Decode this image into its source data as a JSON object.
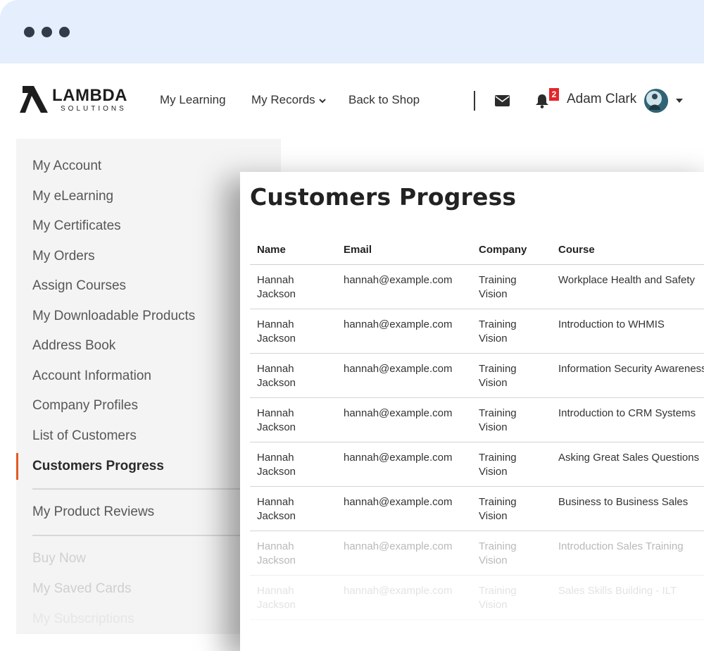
{
  "header": {
    "logo_text": "LAMBDA",
    "logo_sub": "SOLUTIONS",
    "nav": {
      "my_learning": "My Learning",
      "my_records": "My Records",
      "back_to_shop": "Back to Shop"
    },
    "notification_count": "2",
    "user_name": "Adam Clark",
    "icons": [
      "mail-icon",
      "bell-icon",
      "chevron-down-icon",
      "caret-down-icon"
    ]
  },
  "sidebar": {
    "accent_color": "#e25a22",
    "items": [
      {
        "label": "My Account"
      },
      {
        "label": "My eLearning"
      },
      {
        "label": "My Certificates"
      },
      {
        "label": "My Orders"
      },
      {
        "label": "Assign Courses"
      },
      {
        "label": "My Downloadable Products"
      },
      {
        "label": "Address Book"
      },
      {
        "label": "Account Information"
      },
      {
        "label": "Company Profiles"
      },
      {
        "label": "List of Customers"
      },
      {
        "label": "Customers Progress",
        "active": true
      },
      {
        "label": "My Product Reviews"
      },
      {
        "label": "Buy Now"
      },
      {
        "label": "My Saved Cards"
      },
      {
        "label": "My Subscriptions"
      }
    ]
  },
  "main": {
    "title": "Customers Progress",
    "columns": [
      "Name",
      "Email",
      "Company",
      "Course"
    ],
    "rows": [
      {
        "name": "Hannah Jackson",
        "email": "hannah@example.com",
        "company": "Training Vision",
        "course": "Workplace Health and Safety"
      },
      {
        "name": "Hannah Jackson",
        "email": "hannah@example.com",
        "company": "Training Vision",
        "course": "Introduction to WHMIS"
      },
      {
        "name": "Hannah Jackson",
        "email": "hannah@example.com",
        "company": "Training Vision",
        "course": "Information Security Awareness"
      },
      {
        "name": "Hannah Jackson",
        "email": "hannah@example.com",
        "company": "Training Vision",
        "course": "Introduction to CRM Systems"
      },
      {
        "name": "Hannah Jackson",
        "email": "hannah@example.com",
        "company": "Training Vision",
        "course": "Asking Great Sales Questions"
      },
      {
        "name": "Hannah Jackson",
        "email": "hannah@example.com",
        "company": "Training Vision",
        "course": "Business to Business Sales"
      },
      {
        "name": "Hannah Jackson",
        "email": "hannah@example.com",
        "company": "Training Vision",
        "course": "Introduction Sales Training"
      },
      {
        "name": "Hannah Jackson",
        "email": "hannah@example.com",
        "company": "Training Vision",
        "course": "Sales Skills Building - ILT"
      }
    ]
  }
}
